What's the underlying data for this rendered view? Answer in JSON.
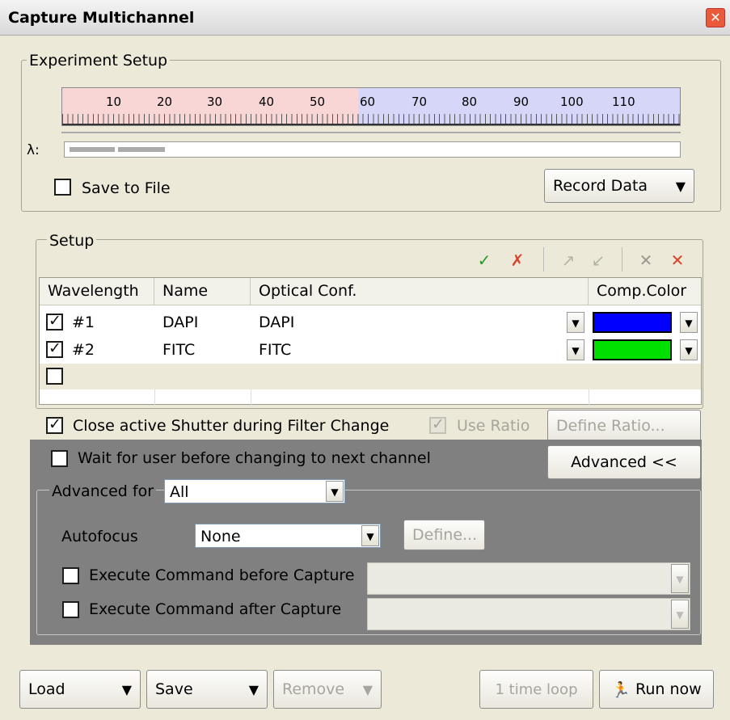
{
  "window": {
    "title": "Capture Multichannel",
    "close_glyph": "✕"
  },
  "experiment": {
    "legend": "Experiment Setup",
    "ruler_ticks": [
      "10",
      "20",
      "30",
      "40",
      "50",
      "60",
      "70",
      "80",
      "90",
      "100",
      "110"
    ],
    "lambda_label": "λ:",
    "save_to_file_label": "Save to File",
    "save_to_file_checked": false,
    "record_data_label": "Record Data"
  },
  "setup": {
    "legend": "Setup",
    "toolbar_icons": [
      "check-all-icon",
      "uncheck-all-icon",
      "move-up-icon",
      "move-down-icon",
      "delete-icon",
      "delete-all-icon"
    ],
    "columns": [
      "Wavelength",
      "Name",
      "Optical Conf.",
      "Comp.Color"
    ],
    "rows": [
      {
        "checked": true,
        "wavelength": "#1",
        "name": "DAPI",
        "optical_conf": "DAPI",
        "color": "#0000ff"
      },
      {
        "checked": true,
        "wavelength": "#2",
        "name": "FITC",
        "optical_conf": "FITC",
        "color": "#00e000"
      },
      {
        "checked": false,
        "wavelength": "",
        "name": "",
        "optical_conf": "",
        "color": ""
      }
    ]
  },
  "options": {
    "close_shutter_label": "Close active Shutter during Filter Change",
    "close_shutter_checked": true,
    "use_ratio_label": "Use Ratio",
    "use_ratio_checked": true,
    "define_ratio_label": "Define Ratio...",
    "wait_user_label": "Wait for user before changing to next channel",
    "wait_user_checked": false,
    "advanced_label": "Advanced <<"
  },
  "advanced": {
    "legend_label": "Advanced for",
    "advanced_for_value": "All",
    "autofocus_label": "Autofocus",
    "autofocus_value": "None",
    "define_label": "Define...",
    "exec_before_label": "Execute Command before Capture",
    "exec_after_label": "Execute Command after Capture"
  },
  "footer": {
    "load_label": "Load",
    "save_label": "Save",
    "remove_label": "Remove",
    "time_loop_label": "1 time loop",
    "run_now_label": "Run now"
  }
}
